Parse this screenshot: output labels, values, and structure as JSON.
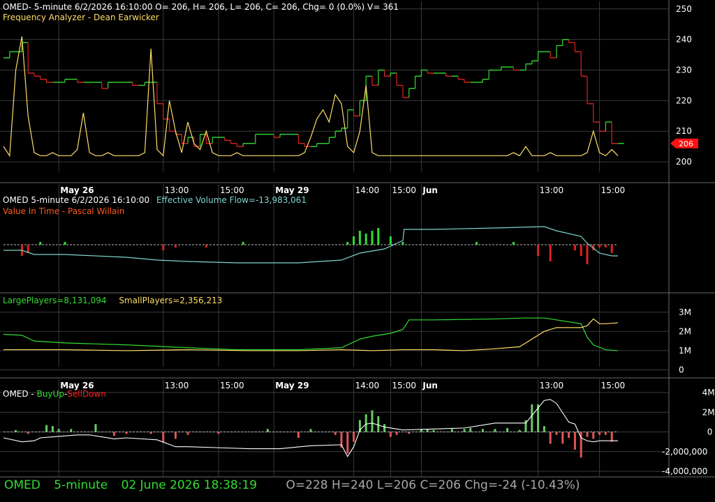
{
  "colors": {
    "bg": "#000000",
    "grid": "#3a3a3a",
    "border": "#6a6a6a",
    "text": "#ffffff",
    "green": "#33dd33",
    "red": "#dd2222",
    "yellow": "#ffdd66",
    "cyan": "#7fd6cc",
    "orange": "#ff5a1f",
    "status_green": "#33dd33",
    "status_gray": "#a8a8a8",
    "lowlabel": "#ff1111"
  },
  "panel1": {
    "header": "OMED- 5-minute 6/2/2026 16:10:00 O= 206, H= 206, L= 206, C= 206, Chg= 0 (0.0%) V= 361",
    "indicator": "Frequency Analyzer - Dean Earwicker",
    "last_price_label": "206"
  },
  "time_axis": {
    "labels": [
      {
        "text": "May 26",
        "bold": true
      },
      {
        "text": "13:00",
        "bold": false
      },
      {
        "text": "15:00",
        "bold": false
      },
      {
        "text": "May 29",
        "bold": true
      },
      {
        "text": "14:00",
        "bold": false
      },
      {
        "text": "15:00",
        "bold": false
      },
      {
        "text": "Jun",
        "bold": true
      },
      {
        "text": "13:00",
        "bold": false
      },
      {
        "text": "15:00",
        "bold": false
      }
    ]
  },
  "panel2": {
    "header": "OMED 5-minute  6/2/2026 16:10:00",
    "evf_label": "Effective Volume Flow=-13,983,061",
    "indicator": "Value In Time - Pascal Willain"
  },
  "panel3": {
    "large_label": "LargePlayers=8,131,094",
    "small_label": "SmallPlayers=2,356,213"
  },
  "panel4": {
    "prefix": "OMED - ",
    "buy_label": "BuyUp",
    "sep": "-",
    "sell_label": "SellDown"
  },
  "status_bar": {
    "symbol": "OMED",
    "interval": "5-minute",
    "datetime": "02 June 2026 18:38:19",
    "ohlc": "O=228  H=240  L=206  C=206  Chg=-24 (-10.43%)"
  },
  "chart_data": [
    {
      "type": "line",
      "title": "OMED 5-minute price with Frequency Analyzer",
      "y_ticks": [
        200,
        210,
        220,
        230,
        240,
        250
      ],
      "ylim": [
        195,
        252
      ],
      "xlim": [
        0,
        100
      ],
      "x_ticks": [
        9,
        26,
        35,
        44,
        57,
        63,
        68,
        87,
        97
      ],
      "series": [
        {
          "name": "price",
          "kind": "step",
          "x": [
            0,
            1,
            2,
            3,
            4,
            5,
            6,
            7,
            8,
            9,
            10,
            11,
            12,
            13,
            14,
            15,
            16,
            17,
            18,
            19,
            20,
            21,
            22,
            23,
            24,
            25,
            26,
            27,
            28,
            29,
            30,
            31,
            32,
            33,
            34,
            35,
            36,
            37,
            38,
            39,
            40,
            41,
            42,
            43,
            44,
            45,
            46,
            47,
            48,
            49,
            50,
            51,
            52,
            53,
            54,
            55,
            56,
            57,
            58,
            59,
            60,
            61,
            62,
            63,
            64,
            65,
            66,
            67,
            68,
            69,
            70,
            71,
            72,
            73,
            74,
            75,
            76,
            77,
            78,
            79,
            80,
            81,
            82,
            83,
            84,
            85,
            86,
            87,
            88,
            89,
            90,
            91,
            92,
            93,
            94,
            95,
            96,
            97,
            98,
            99,
            100
          ],
          "y": [
            234,
            236,
            236,
            239,
            229,
            228,
            227,
            226,
            226,
            226,
            227,
            227,
            226,
            226,
            226,
            226,
            224,
            226,
            226,
            226,
            226,
            225,
            225,
            226,
            226,
            219,
            214,
            210,
            209,
            206,
            208,
            205,
            209,
            206,
            208,
            208,
            207,
            206,
            205,
            206,
            206,
            209,
            209,
            209,
            208,
            209,
            209,
            209,
            206,
            205,
            205,
            206,
            206,
            208,
            210,
            211,
            217,
            215,
            220,
            228,
            225,
            230,
            228,
            229,
            225,
            221,
            224,
            228,
            230,
            229,
            229,
            229,
            228,
            228,
            227,
            226,
            226,
            226,
            227,
            230,
            230,
            231,
            231,
            230,
            230,
            232,
            233,
            236,
            236,
            234,
            238,
            240,
            239,
            236,
            228,
            219,
            213,
            210,
            213,
            206,
            206
          ]
        },
        {
          "name": "Frequency Analyzer",
          "kind": "line",
          "x": [
            0,
            1,
            2,
            3,
            4,
            5,
            6,
            7,
            8,
            9,
            10,
            11,
            12,
            13,
            14,
            15,
            16,
            17,
            18,
            19,
            20,
            21,
            22,
            23,
            24,
            25,
            26,
            27,
            28,
            29,
            30,
            31,
            32,
            33,
            34,
            35,
            36,
            37,
            38,
            39,
            40,
            41,
            42,
            43,
            44,
            45,
            46,
            47,
            48,
            49,
            50,
            51,
            52,
            53,
            54,
            55,
            56,
            57,
            58,
            59,
            60,
            61,
            62,
            63,
            64,
            65,
            66,
            67,
            68,
            69,
            70,
            71,
            72,
            73,
            74,
            75,
            76,
            77,
            78,
            79,
            80,
            81,
            82,
            83,
            84,
            85,
            86,
            87,
            88,
            89,
            90,
            91,
            92,
            93,
            94,
            95,
            96,
            97,
            98,
            99,
            100
          ],
          "y": [
            205,
            202,
            230,
            241,
            215,
            203,
            202,
            202,
            203,
            202,
            202,
            202,
            204,
            216,
            203,
            202,
            202,
            203,
            202,
            202,
            202,
            202,
            202,
            203,
            237,
            204,
            202,
            220,
            210,
            203,
            213,
            206,
            204,
            210,
            203,
            202,
            202,
            202,
            203,
            202,
            202,
            202,
            202,
            202,
            202,
            202,
            202,
            202,
            202,
            203,
            208,
            214,
            217,
            213,
            222,
            219,
            205,
            203,
            210,
            225,
            203,
            202,
            202,
            202,
            202,
            202,
            202,
            202,
            202,
            202,
            202,
            202,
            202,
            202,
            202,
            202,
            202,
            202,
            202,
            202,
            202,
            202,
            202,
            203,
            202,
            205,
            202,
            202,
            202,
            203,
            202,
            202,
            202,
            202,
            202,
            203,
            210,
            203,
            202,
            204,
            202
          ]
        }
      ]
    },
    {
      "type": "line",
      "title": "Effective Volume Flow / Value In Time",
      "series": [
        {
          "name": "Effective Volume Flow",
          "kind": "line",
          "x": [
            0,
            3,
            5,
            10,
            20,
            25,
            30,
            38,
            48,
            55,
            58,
            62,
            65,
            65.2,
            70,
            80,
            88,
            90,
            94,
            95,
            97,
            99,
            100
          ],
          "y": [
            -4,
            -4,
            -7,
            -7,
            -9,
            -11,
            -12,
            -13,
            -13,
            -11,
            -6,
            -3,
            3,
            11,
            11,
            12,
            13,
            10,
            6,
            1,
            -6,
            -8,
            -8
          ]
        },
        {
          "name": "Value In Time",
          "kind": "bar",
          "x": [
            3,
            4,
            6,
            10,
            26,
            28,
            33,
            39,
            56,
            57,
            58,
            59,
            60,
            61,
            63,
            65,
            77,
            83,
            87,
            89,
            93,
            94,
            95,
            96,
            97,
            98,
            99
          ],
          "y": [
            -4,
            -3,
            1,
            1,
            -2,
            -1,
            -1,
            1,
            1,
            3,
            5,
            4,
            5,
            6,
            3,
            1,
            1,
            1,
            -4,
            -6,
            -2,
            -4,
            -7,
            -2,
            -1,
            -1,
            -3
          ]
        }
      ]
    },
    {
      "type": "line",
      "y_ticks": [
        "0",
        "1M",
        "2M",
        "3M"
      ],
      "ylim": [
        -0.2,
        3.5
      ],
      "series": [
        {
          "name": "LargePlayers",
          "kind": "line",
          "x": [
            0,
            3,
            5,
            10,
            20,
            30,
            38,
            48,
            55,
            58,
            60,
            63,
            65,
            66,
            70,
            80,
            85,
            88,
            94,
            95,
            96,
            98,
            100
          ],
          "y": [
            1.85,
            1.8,
            1.5,
            1.4,
            1.3,
            1.15,
            1.05,
            1.05,
            1.15,
            1.6,
            1.75,
            1.9,
            2.1,
            2.6,
            2.6,
            2.65,
            2.7,
            2.7,
            2.4,
            1.7,
            1.3,
            1.05,
            1.0
          ]
        },
        {
          "name": "SmallPlayers",
          "kind": "line",
          "x": [
            0,
            10,
            20,
            30,
            40,
            48,
            55,
            60,
            65,
            70,
            75,
            80,
            84,
            86,
            88,
            90,
            94,
            95,
            96,
            97,
            98,
            100
          ],
          "y": [
            1.05,
            1.05,
            1.0,
            1.05,
            1.0,
            1.0,
            1.05,
            1.0,
            1.05,
            1.05,
            1.0,
            1.1,
            1.2,
            1.6,
            2.0,
            2.2,
            2.2,
            2.3,
            2.65,
            2.4,
            2.4,
            2.45
          ]
        }
      ]
    },
    {
      "type": "line",
      "y_ticks": [
        "-4,000,000",
        "-2,000,000",
        "0",
        "2M",
        "4M"
      ],
      "ylim": [
        -4000000,
        4500000
      ],
      "series": [
        {
          "name": "cumulative",
          "kind": "line",
          "x": [
            0,
            3,
            5,
            6,
            8,
            10,
            12,
            14,
            16,
            18,
            20,
            25,
            28,
            30,
            35,
            40,
            45,
            50,
            55,
            56,
            57,
            58,
            59,
            60,
            62,
            65,
            70,
            75,
            78,
            80,
            85,
            88,
            89,
            90,
            92,
            93,
            94,
            95,
            96,
            97,
            98,
            100
          ],
          "y": [
            -600000,
            -1000000,
            -900000,
            -600000,
            -500000,
            -400000,
            -300000,
            -300000,
            -500000,
            -700000,
            -600000,
            -800000,
            -1500000,
            -1500000,
            -1600000,
            -1700000,
            -1700000,
            -1400000,
            -1300000,
            -2500000,
            -1500000,
            200000,
            800000,
            900000,
            500000,
            200000,
            300000,
            400000,
            700000,
            900000,
            900000,
            3200000,
            3300000,
            2900000,
            1000000,
            800000,
            -600000,
            -900000,
            -1000000,
            -900000,
            -900000,
            -900000
          ]
        },
        {
          "name": "BuyUp-SellDown",
          "kind": "bar",
          "x": [
            2,
            4,
            7,
            8,
            9,
            11,
            15,
            18,
            20,
            24,
            26,
            28,
            30,
            35,
            43,
            48,
            50,
            54,
            55,
            56,
            57,
            58,
            59,
            60,
            61,
            62,
            63,
            64,
            66,
            68,
            69,
            70,
            73,
            75,
            76,
            78,
            80,
            82,
            84,
            85,
            86,
            87,
            88,
            89,
            90,
            91,
            92,
            93,
            94,
            95,
            96,
            97,
            98,
            99
          ],
          "y": [
            200000,
            -200000,
            700000,
            600000,
            300000,
            300000,
            800000,
            -400000,
            -200000,
            -200000,
            -1100000,
            -700000,
            -300000,
            -200000,
            300000,
            -600000,
            300000,
            -300000,
            -1600000,
            -2200000,
            -1000000,
            1200000,
            1800000,
            2200000,
            1600000,
            800000,
            -500000,
            -300000,
            -200000,
            300000,
            300000,
            200000,
            300000,
            300000,
            400000,
            300000,
            300000,
            400000,
            200000,
            1200000,
            2800000,
            2800000,
            600000,
            -1200000,
            -300000,
            -1200000,
            -600000,
            -1800000,
            -2600000,
            -500000,
            -700000,
            -300000,
            -300000,
            -1000000
          ]
        }
      ]
    }
  ]
}
